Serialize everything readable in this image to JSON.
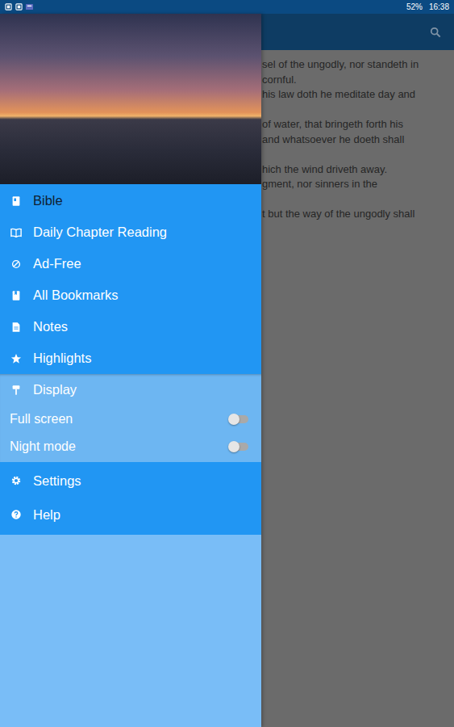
{
  "status_bar": {
    "battery": "52%",
    "time": "16:38"
  },
  "background": {
    "verses": [
      [
        "sel of the ungodly, nor standeth in",
        "cornful.",
        "his law doth he meditate day and"
      ],
      [
        "of water, that bringeth forth his",
        "and whatsoever he doeth shall"
      ],
      [
        "hich the wind driveth away.",
        "gment, nor sinners in the"
      ],
      [
        "t but the way of the ungodly shall"
      ]
    ]
  },
  "drawer": {
    "items": [
      {
        "label": "Bible",
        "selected": true
      },
      {
        "label": "Daily Chapter Reading",
        "selected": false
      },
      {
        "label": "Ad-Free",
        "selected": false
      },
      {
        "label": "All Bookmarks",
        "selected": false
      },
      {
        "label": "Notes",
        "selected": false
      },
      {
        "label": "Highlights",
        "selected": false
      }
    ],
    "display": {
      "label": "Display",
      "toggles": [
        {
          "label": "Full screen",
          "on": false
        },
        {
          "label": "Night mode",
          "on": false
        }
      ]
    },
    "footer_items": [
      {
        "label": "Settings"
      },
      {
        "label": "Help"
      }
    ]
  }
}
